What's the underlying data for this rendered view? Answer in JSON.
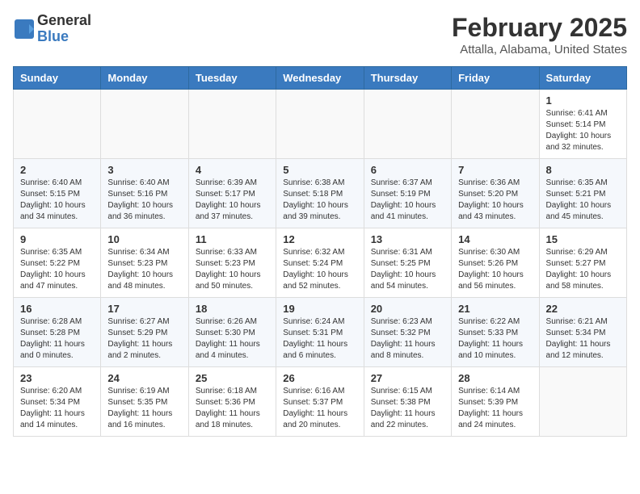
{
  "header": {
    "logo_line1": "General",
    "logo_line2": "Blue",
    "month": "February 2025",
    "location": "Attalla, Alabama, United States"
  },
  "weekdays": [
    "Sunday",
    "Monday",
    "Tuesday",
    "Wednesday",
    "Thursday",
    "Friday",
    "Saturday"
  ],
  "weeks": [
    [
      {
        "day": "",
        "info": ""
      },
      {
        "day": "",
        "info": ""
      },
      {
        "day": "",
        "info": ""
      },
      {
        "day": "",
        "info": ""
      },
      {
        "day": "",
        "info": ""
      },
      {
        "day": "",
        "info": ""
      },
      {
        "day": "1",
        "info": "Sunrise: 6:41 AM\nSunset: 5:14 PM\nDaylight: 10 hours and 32 minutes."
      }
    ],
    [
      {
        "day": "2",
        "info": "Sunrise: 6:40 AM\nSunset: 5:15 PM\nDaylight: 10 hours and 34 minutes."
      },
      {
        "day": "3",
        "info": "Sunrise: 6:40 AM\nSunset: 5:16 PM\nDaylight: 10 hours and 36 minutes."
      },
      {
        "day": "4",
        "info": "Sunrise: 6:39 AM\nSunset: 5:17 PM\nDaylight: 10 hours and 37 minutes."
      },
      {
        "day": "5",
        "info": "Sunrise: 6:38 AM\nSunset: 5:18 PM\nDaylight: 10 hours and 39 minutes."
      },
      {
        "day": "6",
        "info": "Sunrise: 6:37 AM\nSunset: 5:19 PM\nDaylight: 10 hours and 41 minutes."
      },
      {
        "day": "7",
        "info": "Sunrise: 6:36 AM\nSunset: 5:20 PM\nDaylight: 10 hours and 43 minutes."
      },
      {
        "day": "8",
        "info": "Sunrise: 6:35 AM\nSunset: 5:21 PM\nDaylight: 10 hours and 45 minutes."
      }
    ],
    [
      {
        "day": "9",
        "info": "Sunrise: 6:35 AM\nSunset: 5:22 PM\nDaylight: 10 hours and 47 minutes."
      },
      {
        "day": "10",
        "info": "Sunrise: 6:34 AM\nSunset: 5:23 PM\nDaylight: 10 hours and 48 minutes."
      },
      {
        "day": "11",
        "info": "Sunrise: 6:33 AM\nSunset: 5:23 PM\nDaylight: 10 hours and 50 minutes."
      },
      {
        "day": "12",
        "info": "Sunrise: 6:32 AM\nSunset: 5:24 PM\nDaylight: 10 hours and 52 minutes."
      },
      {
        "day": "13",
        "info": "Sunrise: 6:31 AM\nSunset: 5:25 PM\nDaylight: 10 hours and 54 minutes."
      },
      {
        "day": "14",
        "info": "Sunrise: 6:30 AM\nSunset: 5:26 PM\nDaylight: 10 hours and 56 minutes."
      },
      {
        "day": "15",
        "info": "Sunrise: 6:29 AM\nSunset: 5:27 PM\nDaylight: 10 hours and 58 minutes."
      }
    ],
    [
      {
        "day": "16",
        "info": "Sunrise: 6:28 AM\nSunset: 5:28 PM\nDaylight: 11 hours and 0 minutes."
      },
      {
        "day": "17",
        "info": "Sunrise: 6:27 AM\nSunset: 5:29 PM\nDaylight: 11 hours and 2 minutes."
      },
      {
        "day": "18",
        "info": "Sunrise: 6:26 AM\nSunset: 5:30 PM\nDaylight: 11 hours and 4 minutes."
      },
      {
        "day": "19",
        "info": "Sunrise: 6:24 AM\nSunset: 5:31 PM\nDaylight: 11 hours and 6 minutes."
      },
      {
        "day": "20",
        "info": "Sunrise: 6:23 AM\nSunset: 5:32 PM\nDaylight: 11 hours and 8 minutes."
      },
      {
        "day": "21",
        "info": "Sunrise: 6:22 AM\nSunset: 5:33 PM\nDaylight: 11 hours and 10 minutes."
      },
      {
        "day": "22",
        "info": "Sunrise: 6:21 AM\nSunset: 5:34 PM\nDaylight: 11 hours and 12 minutes."
      }
    ],
    [
      {
        "day": "23",
        "info": "Sunrise: 6:20 AM\nSunset: 5:34 PM\nDaylight: 11 hours and 14 minutes."
      },
      {
        "day": "24",
        "info": "Sunrise: 6:19 AM\nSunset: 5:35 PM\nDaylight: 11 hours and 16 minutes."
      },
      {
        "day": "25",
        "info": "Sunrise: 6:18 AM\nSunset: 5:36 PM\nDaylight: 11 hours and 18 minutes."
      },
      {
        "day": "26",
        "info": "Sunrise: 6:16 AM\nSunset: 5:37 PM\nDaylight: 11 hours and 20 minutes."
      },
      {
        "day": "27",
        "info": "Sunrise: 6:15 AM\nSunset: 5:38 PM\nDaylight: 11 hours and 22 minutes."
      },
      {
        "day": "28",
        "info": "Sunrise: 6:14 AM\nSunset: 5:39 PM\nDaylight: 11 hours and 24 minutes."
      },
      {
        "day": "",
        "info": ""
      }
    ]
  ]
}
